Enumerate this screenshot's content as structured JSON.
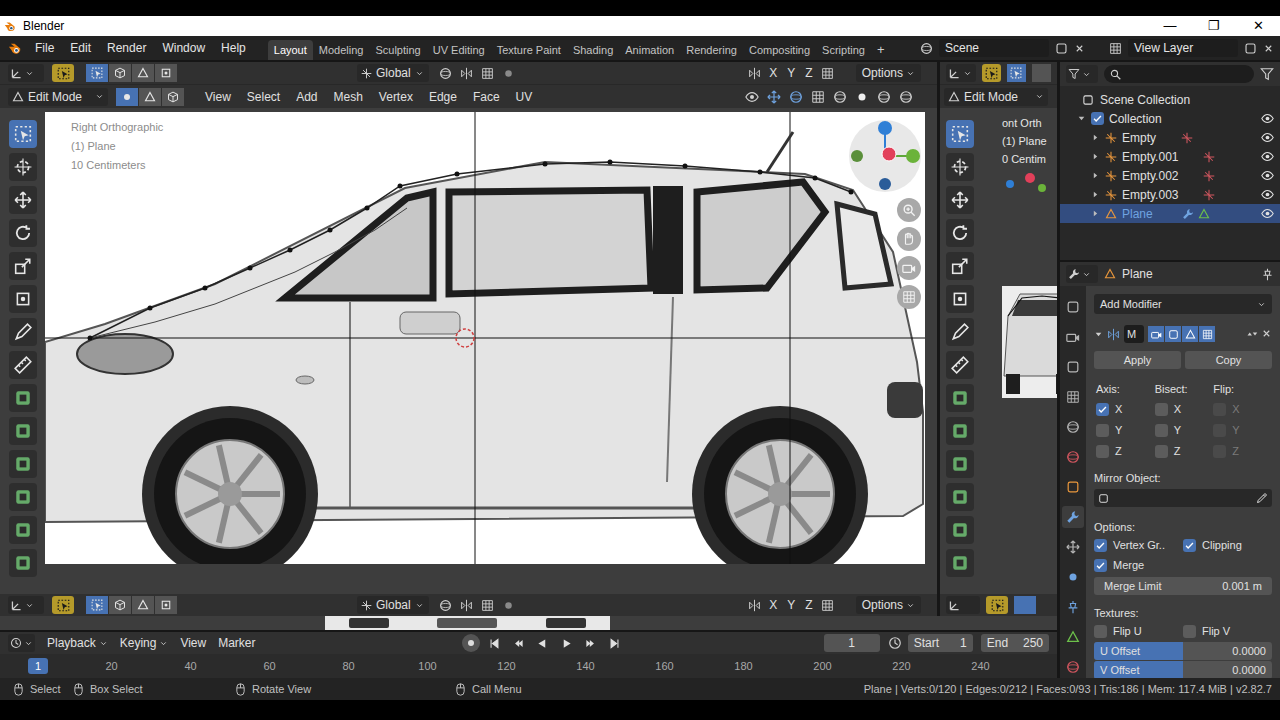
{
  "window": {
    "title": "Blender",
    "controls": [
      "—",
      "❐",
      "✕"
    ]
  },
  "menu": [
    "File",
    "Edit",
    "Render",
    "Window",
    "Help"
  ],
  "workspaces": [
    {
      "label": "Layout",
      "selected": true
    },
    {
      "label": "Modeling",
      "selected": false
    },
    {
      "label": "Sculpting",
      "selected": false
    },
    {
      "label": "UV Editing",
      "selected": false
    },
    {
      "label": "Texture Paint",
      "selected": false
    },
    {
      "label": "Shading",
      "selected": false
    },
    {
      "label": "Animation",
      "selected": false
    },
    {
      "label": "Rendering",
      "selected": false
    },
    {
      "label": "Compositing",
      "selected": false
    },
    {
      "label": "Scripting",
      "selected": false
    }
  ],
  "add_workspace": "+",
  "scene": "Scene",
  "view_layer": "View Layer",
  "main_view": {
    "orientation": "Global",
    "axes": [
      "X",
      "Y",
      "Z"
    ],
    "options": "Options",
    "mode": "Edit Mode",
    "menus": [
      "View",
      "Select",
      "Add",
      "Mesh",
      "Vertex",
      "Edge",
      "Face",
      "UV"
    ],
    "overlay": [
      "Right Orthographic",
      "(1) Plane",
      "10 Centimeters"
    ],
    "select_modes": [
      {
        "selected": true
      },
      {
        "selected": false
      },
      {
        "selected": false
      },
      {
        "selected": false
      }
    ],
    "element_modes": [
      {
        "selected": true
      },
      {
        "selected": false
      },
      {
        "selected": false
      }
    ],
    "tools": [
      {
        "selected": true
      },
      {
        "selected": false
      },
      {
        "selected": false
      },
      {
        "selected": false
      },
      {
        "selected": false
      },
      {
        "selected": false
      },
      {
        "selected": false
      },
      {
        "selected": false
      },
      {
        "selected": false
      },
      {
        "selected": false
      },
      {
        "selected": false
      },
      {
        "selected": false
      },
      {
        "selected": false
      },
      {
        "selected": false
      }
    ]
  },
  "side_view": {
    "mode": "Edit Mode",
    "overlay": [
      "ont Orth",
      "(1) Plane",
      "0 Centim"
    ],
    "tools": [
      {
        "selected": true
      },
      {
        "selected": false
      },
      {
        "selected": false
      },
      {
        "selected": false
      },
      {
        "selected": false
      },
      {
        "selected": false
      },
      {
        "selected": false
      },
      {
        "selected": false
      },
      {
        "selected": false
      },
      {
        "selected": false
      },
      {
        "selected": false
      },
      {
        "selected": false
      },
      {
        "selected": false
      },
      {
        "selected": false
      }
    ]
  },
  "outliner": {
    "root": "Scene Collection",
    "items": [
      {
        "label": "Collection",
        "kind": "collection",
        "selected": false,
        "visible": true
      },
      {
        "label": "Empty",
        "kind": "empty",
        "selected": false,
        "visible": true
      },
      {
        "label": "Empty.001",
        "kind": "empty",
        "selected": false,
        "visible": true
      },
      {
        "label": "Empty.002",
        "kind": "empty",
        "selected": false,
        "visible": true
      },
      {
        "label": "Empty.003",
        "kind": "empty",
        "selected": false,
        "visible": true
      },
      {
        "label": "Plane",
        "kind": "mesh",
        "selected": true,
        "visible": true
      }
    ]
  },
  "properties": {
    "object": "Plane",
    "tabs": [
      {
        "selected": false,
        "color": "#b5b5b5"
      },
      {
        "selected": false,
        "color": "#b5b5b5"
      },
      {
        "selected": false,
        "color": "#b5b5b5"
      },
      {
        "selected": false,
        "color": "#b5b5b5"
      },
      {
        "selected": false,
        "color": "#b5b5b5"
      },
      {
        "selected": false,
        "color": "#d2565f"
      },
      {
        "selected": false,
        "color": "#e8963c"
      },
      {
        "selected": true,
        "color": "#6fa3e0"
      },
      {
        "selected": false,
        "color": "#b5b5b5"
      },
      {
        "selected": false,
        "color": "#6fa3e0"
      },
      {
        "selected": false,
        "color": "#6fa3e0"
      },
      {
        "selected": false,
        "color": "#6cc04a"
      },
      {
        "selected": false,
        "color": "#d2565f"
      }
    ],
    "add_modifier": "Add Modifier",
    "modifier_name": "M",
    "apply": "Apply",
    "copy": "Copy",
    "axis_groups": [
      {
        "label": "Axis:",
        "disabled": false,
        "items": [
          {
            "label": "X",
            "checked": true
          },
          {
            "label": "Y",
            "checked": false
          },
          {
            "label": "Z",
            "checked": false
          }
        ]
      },
      {
        "label": "Bisect:",
        "disabled": false,
        "items": [
          {
            "label": "X",
            "checked": false
          },
          {
            "label": "Y",
            "checked": false
          },
          {
            "label": "Z",
            "checked": false
          }
        ]
      },
      {
        "label": "Flip:",
        "disabled": true,
        "items": [
          {
            "label": "X",
            "checked": false
          },
          {
            "label": "Y",
            "checked": false
          },
          {
            "label": "Z",
            "checked": false
          }
        ]
      }
    ],
    "mirror_object": "Mirror Object:",
    "options_label": "Options:",
    "options": [
      {
        "label": "Vertex Gr..",
        "checked": true
      },
      {
        "label": "Clipping",
        "checked": true
      },
      {
        "label": "Merge",
        "checked": true
      }
    ],
    "merge_limit": {
      "label": "Merge Limit",
      "value": "0.001 m"
    },
    "textures_label": "Textures:",
    "texture_flips": [
      {
        "label": "Flip U",
        "checked": false
      },
      {
        "label": "Flip V",
        "checked": false
      }
    ],
    "offsets": [
      {
        "label": "U Offset",
        "value": "0.0000",
        "level": 0.5
      },
      {
        "label": "V Offset",
        "value": "0.0000",
        "level": 0.5
      }
    ]
  },
  "bottom_view": {
    "orientation": "Global",
    "axes": [
      "X",
      "Y",
      "Z"
    ],
    "options": "Options",
    "select_modes": [
      {
        "selected": true
      },
      {
        "selected": false
      },
      {
        "selected": false
      },
      {
        "selected": false
      }
    ]
  },
  "timeline": {
    "menus": [
      {
        "label": "Playback",
        "kind": "dropdown"
      },
      {
        "label": "Keying",
        "kind": "dropdown"
      },
      {
        "label": "View",
        "kind": "menu"
      },
      {
        "label": "Marker",
        "kind": "menu"
      }
    ],
    "current_frame": "1",
    "start_label": "Start",
    "start": "1",
    "end_label": "End",
    "end": "250",
    "playhead": "1",
    "ticks": [
      "20",
      "40",
      "60",
      "80",
      "100",
      "120",
      "140",
      "160",
      "180",
      "200",
      "220",
      "240"
    ]
  },
  "status_bar": {
    "hints": [
      "Select",
      "Box Select",
      "Rotate View",
      "Call Menu"
    ],
    "stats": "Plane | Verts:0/120 | Edges:0/212 | Faces:0/93 | Tris:186 | Mem: 117.4 MiB | v2.82.7"
  }
}
